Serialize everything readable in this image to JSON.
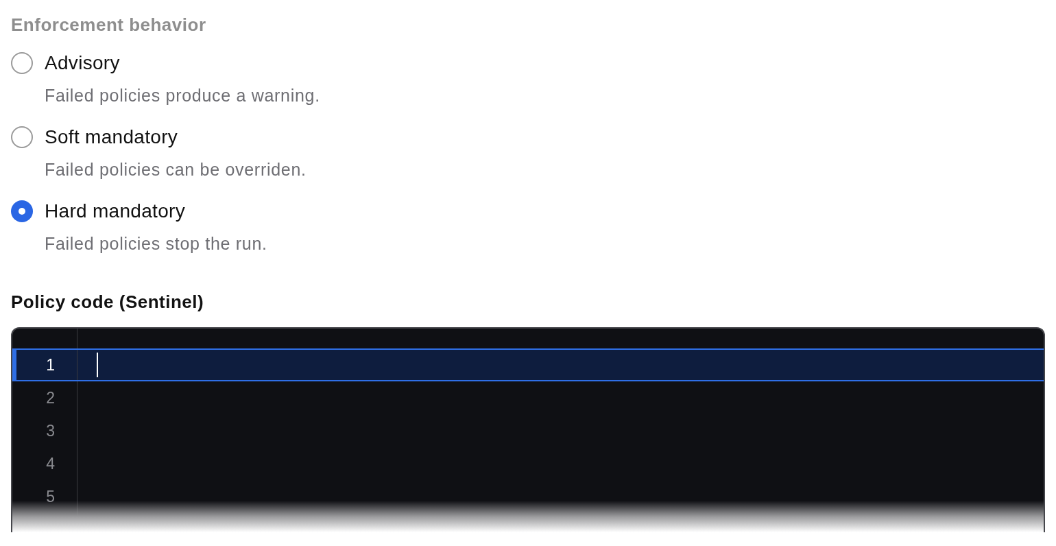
{
  "enforcement": {
    "heading": "Enforcement behavior",
    "options": [
      {
        "label": "Advisory",
        "description": "Failed policies produce a warning.",
        "selected": false
      },
      {
        "label": "Soft mandatory",
        "description": "Failed policies can be overriden.",
        "selected": false
      },
      {
        "label": "Hard mandatory",
        "description": "Failed policies stop the run.",
        "selected": true
      }
    ]
  },
  "policy_code": {
    "label": "Policy code (Sentinel)",
    "editor": {
      "lines": [
        {
          "number": "1",
          "selected": true
        },
        {
          "number": "2",
          "selected": false
        },
        {
          "number": "3",
          "selected": false
        },
        {
          "number": "4",
          "selected": false
        },
        {
          "number": "5",
          "selected": false
        }
      ]
    }
  }
}
